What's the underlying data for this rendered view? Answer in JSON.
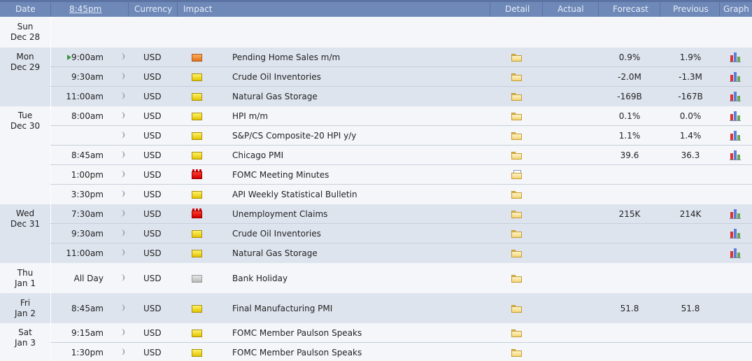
{
  "header": {
    "date": "Date",
    "time": "8:45pm",
    "currency": "Currency",
    "impact": "Impact",
    "detail": "Detail",
    "actual": "Actual",
    "forecast": "Forecast",
    "previous": "Previous",
    "graph": "Graph"
  },
  "days": [
    {
      "day": "Sun",
      "date": "Dec 28"
    },
    {
      "day": "Mon",
      "date": "Dec 29"
    },
    {
      "day": "Tue",
      "date": "Dec 30"
    },
    {
      "day": "Wed",
      "date": "Dec 31"
    },
    {
      "day": "Thu",
      "date": "Jan 1"
    },
    {
      "day": "Fri",
      "date": "Jan 2"
    },
    {
      "day": "Sat",
      "date": "Jan 3"
    }
  ],
  "events": [
    {
      "time": "9:00am",
      "currency": "USD",
      "impact": "orange",
      "event": "Pending Home Sales m/m",
      "actual": "",
      "forecast": "0.9%",
      "previous": "1.9%",
      "graph": true,
      "detail_icon": "folder-icon",
      "current": true
    },
    {
      "time": "9:30am",
      "currency": "USD",
      "impact": "yellow",
      "event": "Crude Oil Inventories",
      "actual": "",
      "forecast": "-2.0M",
      "previous": "-1.3M",
      "graph": true,
      "detail_icon": "folder-icon"
    },
    {
      "time": "11:00am",
      "currency": "USD",
      "impact": "yellow",
      "event": "Natural Gas Storage",
      "actual": "",
      "forecast": "-169B",
      "previous": "-167B",
      "graph": true,
      "detail_icon": "folder-icon"
    },
    {
      "time": "8:00am",
      "currency": "USD",
      "impact": "yellow",
      "event": "HPI m/m",
      "actual": "",
      "forecast": "0.1%",
      "previous": "0.0%",
      "graph": true,
      "detail_icon": "folder-icon"
    },
    {
      "time": "",
      "currency": "USD",
      "impact": "yellow",
      "event": "S&P/CS Composite-20 HPI y/y",
      "actual": "",
      "forecast": "1.1%",
      "previous": "1.4%",
      "graph": true,
      "detail_icon": "folder-icon"
    },
    {
      "time": "8:45am",
      "currency": "USD",
      "impact": "yellow",
      "event": "Chicago PMI",
      "actual": "",
      "forecast": "39.6",
      "previous": "36.3",
      "graph": true,
      "detail_icon": "folder-icon"
    },
    {
      "time": "1:00pm",
      "currency": "USD",
      "impact": "red",
      "event": "FOMC Meeting Minutes",
      "actual": "",
      "forecast": "",
      "previous": "",
      "graph": false,
      "detail_icon": "document-icon"
    },
    {
      "time": "3:30pm",
      "currency": "USD",
      "impact": "yellow",
      "event": "API Weekly Statistical Bulletin",
      "actual": "",
      "forecast": "",
      "previous": "",
      "graph": false,
      "detail_icon": "folder-icon"
    },
    {
      "time": "7:30am",
      "currency": "USD",
      "impact": "red",
      "event": "Unemployment Claims",
      "actual": "",
      "forecast": "215K",
      "previous": "214K",
      "graph": true,
      "detail_icon": "folder-icon"
    },
    {
      "time": "9:30am",
      "currency": "USD",
      "impact": "yellow",
      "event": "Crude Oil Inventories",
      "actual": "",
      "forecast": "",
      "previous": "",
      "graph": true,
      "detail_icon": "folder-icon"
    },
    {
      "time": "11:00am",
      "currency": "USD",
      "impact": "yellow",
      "event": "Natural Gas Storage",
      "actual": "",
      "forecast": "",
      "previous": "",
      "graph": true,
      "detail_icon": "folder-icon"
    },
    {
      "time": "All Day",
      "currency": "USD",
      "impact": "gray",
      "event": "Bank Holiday",
      "actual": "",
      "forecast": "",
      "previous": "",
      "graph": false,
      "detail_icon": "folder-icon"
    },
    {
      "time": "8:45am",
      "currency": "USD",
      "impact": "yellow",
      "event": "Final Manufacturing PMI",
      "actual": "",
      "forecast": "51.8",
      "previous": "51.8",
      "graph": false,
      "detail_icon": "folder-icon"
    },
    {
      "time": "9:15am",
      "currency": "USD",
      "impact": "yellow",
      "event": "FOMC Member Paulson Speaks",
      "actual": "",
      "forecast": "",
      "previous": "",
      "graph": false,
      "detail_icon": "folder-icon"
    },
    {
      "time": "1:30pm",
      "currency": "USD",
      "impact": "yellow",
      "event": "FOMC Member Paulson Speaks",
      "actual": "",
      "forecast": "",
      "previous": "",
      "graph": false,
      "detail_icon": "folder-icon"
    }
  ],
  "icons": {
    "alert": "sound-alert-icon",
    "graph": "bar-graph-icon"
  },
  "colors": {
    "header_bg": "#6e88b8",
    "impact_high": "#d40000",
    "impact_medium": "#e0721b",
    "impact_low": "#e2c400",
    "impact_holiday": "#b8b8b8"
  }
}
